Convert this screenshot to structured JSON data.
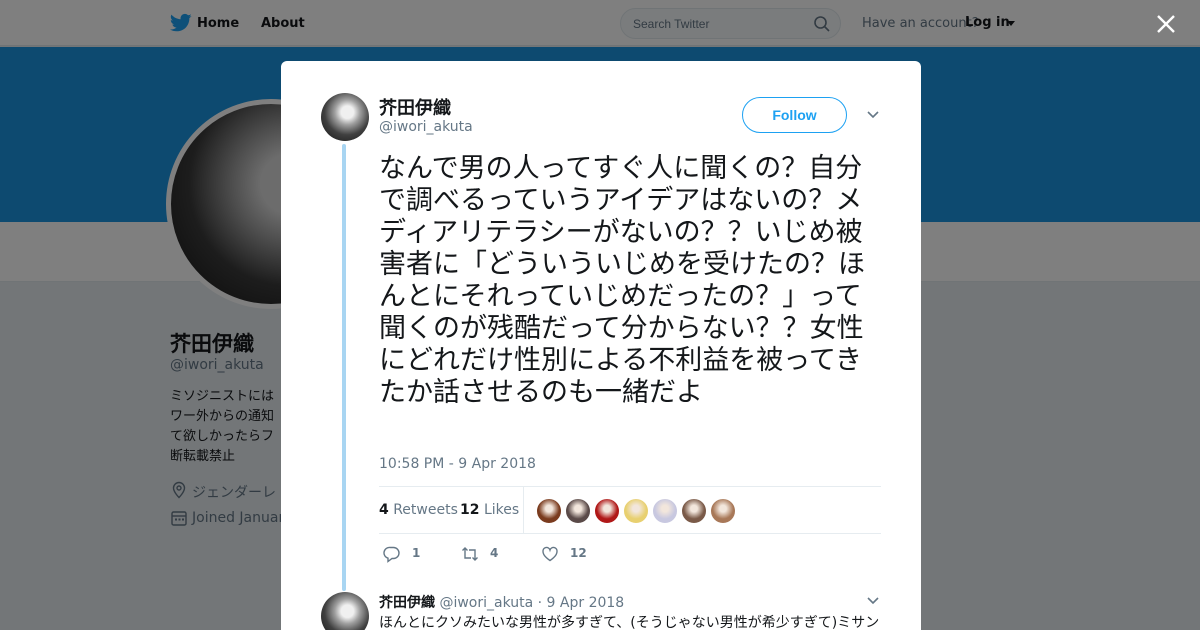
{
  "topbar": {
    "home": "Home",
    "about": "About",
    "search_placeholder": "Search Twitter",
    "have_account": "Have an account?",
    "login": "Log in"
  },
  "profile": {
    "name": "芥田伊織",
    "handle": "@iwori_akuta",
    "bio": "ミソジニストには ワー外からの通知 て欲しかったらフ 断転載禁止",
    "location": "ジェンダーレ",
    "joined": "Joined Januar"
  },
  "tweet": {
    "name": "芥田伊織",
    "handle": "@iwori_akuta",
    "follow": "Follow",
    "text": "なんで男の人ってすぐ人に聞くの？自分で調べるっていうアイデアはないの？メディアリテラシーがないの？？いじめ被害者に「どういういじめを受けたの？ほんとにそれっていじめだったの？」って聞くのが残酷だって分からない？？女性にどれだけ性別による不利益を被ってきたか話させるのも一緒だよ",
    "timestamp": "10:58 PM - 9 Apr 2018",
    "retweets_count": "4",
    "retweets_label": "Retweets",
    "likes_count": "12",
    "likes_label": "Likes",
    "reply_count": "1",
    "retweet_action_count": "4",
    "like_action_count": "12"
  },
  "likers_colors": [
    "#7a3b1e",
    "#5a4a48",
    "#b01818",
    "#e8d070",
    "#c8c8e0",
    "#7a5a48",
    "#a87858"
  ],
  "reply": {
    "name": "芥田伊織",
    "handle": "@iwori_akuta",
    "date": "· 9 Apr 2018",
    "text": "ほんとにクソみたいな男性が多すぎて、(そうじゃない男性が希少すぎて)ミサン"
  },
  "colors": {
    "accent": "#1da1f2",
    "banner": "#1b95e0"
  }
}
